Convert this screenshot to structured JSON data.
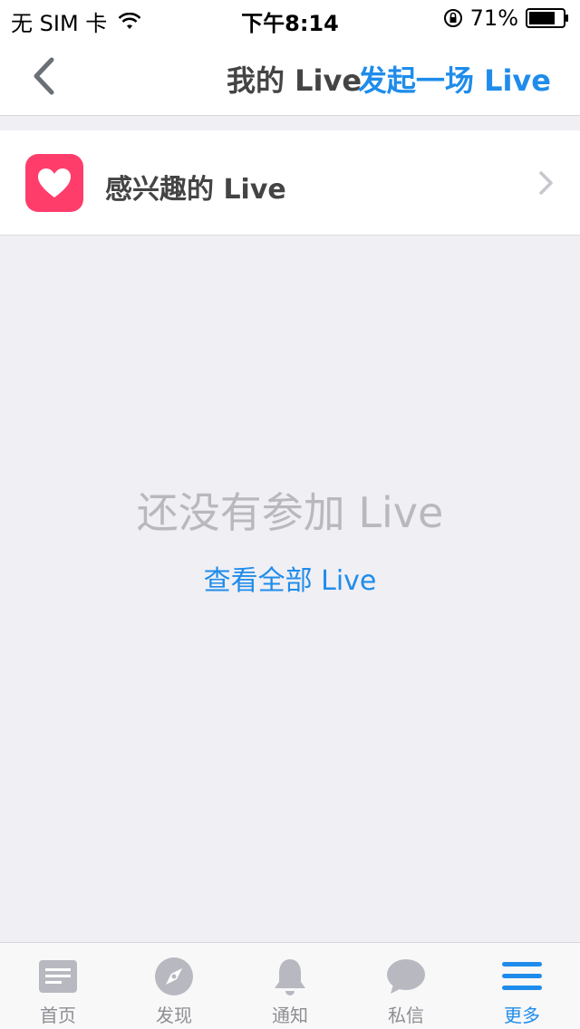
{
  "status_bar": {
    "carrier": "无 SIM 卡",
    "time": "下午8:14",
    "battery": "71%"
  },
  "nav": {
    "title": "我的 Live",
    "action_label": "发起一场 Live"
  },
  "interest": {
    "label": "感兴趣的 Live",
    "icon": "heart-icon",
    "icon_color": "#ff3d6b"
  },
  "empty_state": {
    "title": "还没有参加 Live",
    "link_label": "查看全部 Live"
  },
  "tab_bar": {
    "tabs": [
      {
        "label": "首页",
        "icon": "home-feed-icon",
        "active": false
      },
      {
        "label": "发现",
        "icon": "compass-icon",
        "active": false
      },
      {
        "label": "通知",
        "icon": "bell-icon",
        "active": false
      },
      {
        "label": "私信",
        "icon": "chat-bubble-icon",
        "active": false
      },
      {
        "label": "更多",
        "icon": "menu-icon",
        "active": true
      }
    ]
  },
  "colors": {
    "accent": "#1f8ceb",
    "background": "#efeff4",
    "muted_text": "#b9b9bd",
    "inactive_icon": "#b8b9c0"
  }
}
